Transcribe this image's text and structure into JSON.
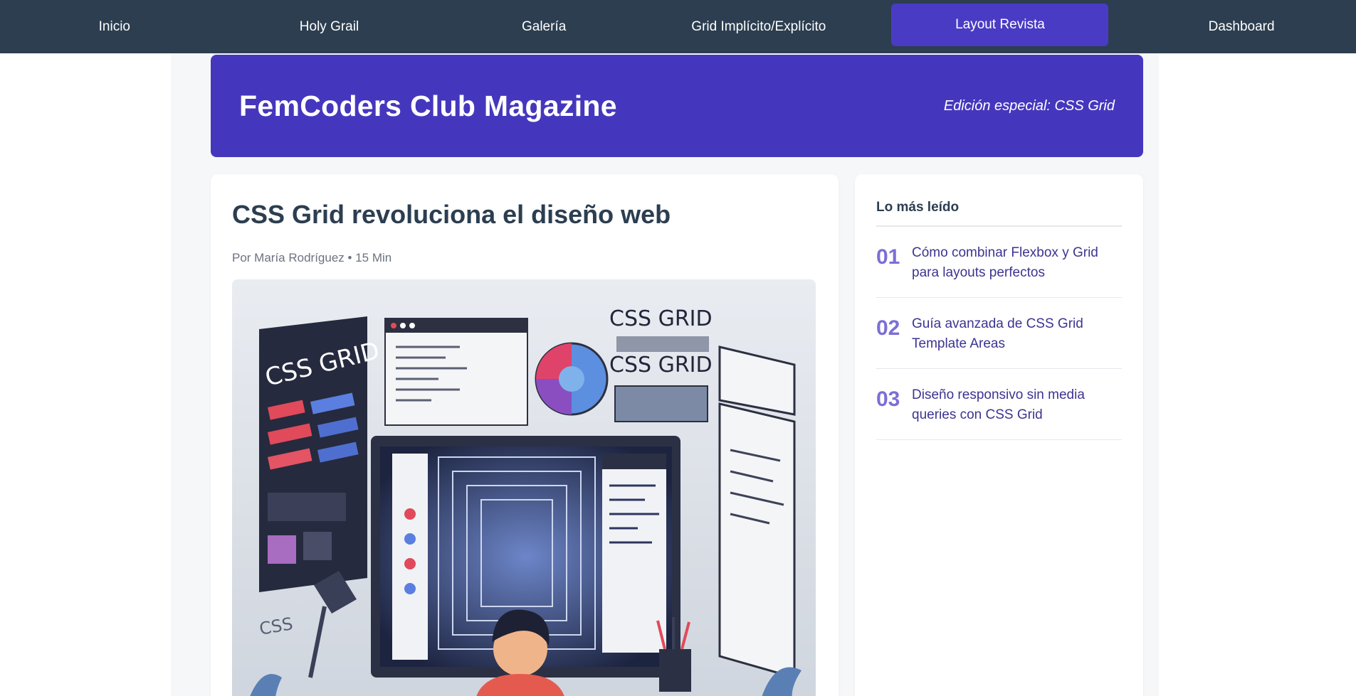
{
  "nav": {
    "items": [
      {
        "label": "Inicio"
      },
      {
        "label": "Holy Grail"
      },
      {
        "label": "Galería"
      },
      {
        "label": "Grid Implícito/Explícito"
      },
      {
        "label": "Layout Revista",
        "active": true
      },
      {
        "label": "Dashboard"
      }
    ]
  },
  "masthead": {
    "title": "FemCoders Club Magazine",
    "edition": "Edición especial: CSS Grid"
  },
  "article": {
    "title": "CSS Grid revoluciona el diseño web",
    "meta": "Por María Rodríguez • 15 Min",
    "image_icon": "css-grid-illustration"
  },
  "sidebar": {
    "heading": "Lo más leído",
    "items": [
      {
        "num": "01",
        "text": "Cómo combinar Flexbox y Grid para layouts perfectos"
      },
      {
        "num": "02",
        "text": "Guía avanzada de CSS Grid Template Areas"
      },
      {
        "num": "03",
        "text": "Diseño responsivo sin media queries con CSS Grid"
      }
    ]
  },
  "colors": {
    "nav_bg": "#2c3e50",
    "accent": "#4537bd",
    "number": "#7b6fd6",
    "link": "#3b3491"
  },
  "illustration": {
    "panel_label": "CSS GRID",
    "side_label": "CSS"
  }
}
